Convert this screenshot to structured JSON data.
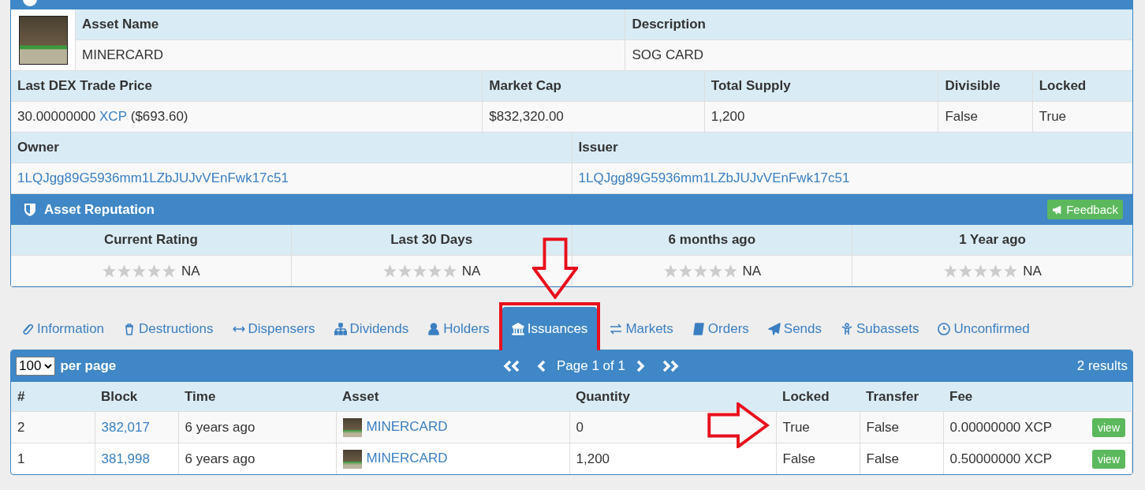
{
  "asset": {
    "name_label": "Asset Name",
    "name": "MINERCARD",
    "description_label": "Description",
    "description": "SOG CARD"
  },
  "market": {
    "columns": [
      "Last DEX Trade Price",
      "Market Cap",
      "Total Supply",
      "Divisible",
      "Locked"
    ],
    "price": {
      "amount": "30.00000000",
      "currency": "XCP",
      "usd": "($693.60)"
    },
    "market_cap": "$832,320.00",
    "total_supply": "1,200",
    "divisible": "False",
    "locked": "True"
  },
  "ownership": {
    "owner_label": "Owner",
    "owner": "1LQJgg89G5936mm1LZbJUJvVEnFwk17c51",
    "issuer_label": "Issuer",
    "issuer": "1LQJgg89G5936mm1LZbJUJvVEnFwk17c51"
  },
  "reputation": {
    "title": "Asset Reputation",
    "feedback_button": "Feedback",
    "ratings": [
      {
        "label": "Current Rating",
        "stars": 0,
        "value": "NA"
      },
      {
        "label": "Last 30 Days",
        "stars": 0,
        "value": "NA"
      },
      {
        "label": "6 months ago",
        "stars": 0,
        "value": "NA"
      },
      {
        "label": "1 Year ago",
        "stars": 0,
        "value": "NA"
      }
    ]
  },
  "tabs": [
    {
      "label": "Information",
      "selected": false
    },
    {
      "label": "Destructions",
      "selected": false
    },
    {
      "label": "Dispensers",
      "selected": false
    },
    {
      "label": "Dividends",
      "selected": false
    },
    {
      "label": "Holders",
      "selected": false
    },
    {
      "label": "Issuances",
      "selected": true
    },
    {
      "label": "Markets",
      "selected": false
    },
    {
      "label": "Orders",
      "selected": false
    },
    {
      "label": "Sends",
      "selected": false
    },
    {
      "label": "Subassets",
      "selected": false
    },
    {
      "label": "Unconfirmed",
      "selected": false
    }
  ],
  "issuances": {
    "per_page_value": "100",
    "per_page_label": "per page",
    "page": "Page 1 of 1",
    "results": "2 results",
    "columns": [
      "#",
      "Block",
      "Time",
      "Asset",
      "Quantity",
      "Locked",
      "Transfer",
      "Fee"
    ],
    "rows": [
      {
        "index": "2",
        "block": "382,017",
        "time": "6 years ago",
        "asset": "MINERCARD",
        "quantity": "0",
        "locked": "True",
        "transfer": "False",
        "fee": "0.00000000 XCP",
        "action": "view"
      },
      {
        "index": "1",
        "block": "381,998",
        "time": "6 years ago",
        "asset": "MINERCARD",
        "quantity": "1,200",
        "locked": "False",
        "transfer": "False",
        "fee": "0.50000000 XCP",
        "action": "view"
      }
    ]
  }
}
